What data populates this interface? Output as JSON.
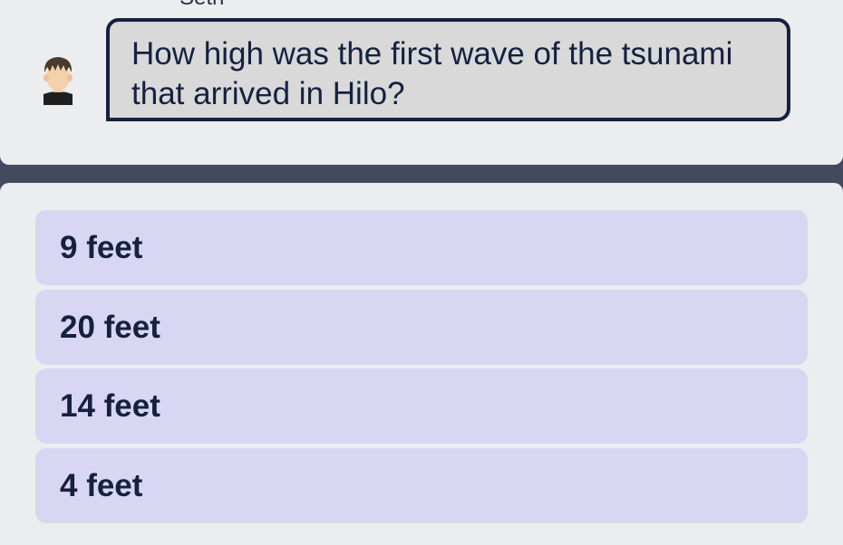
{
  "dialogue": {
    "speaker": "Seth",
    "question": "How high was the first wave of the tsunami that arrived in Hilo?"
  },
  "answers": [
    {
      "label": "9 feet"
    },
    {
      "label": "20 feet"
    },
    {
      "label": "14 feet"
    },
    {
      "label": "4 feet"
    }
  ],
  "colors": {
    "background_divider": "#444a5e",
    "panel": "#ebedee",
    "bubble_fill": "#d9d9d9",
    "bubble_border": "#15213f",
    "answer_fill": "#d8d6f3",
    "text": "#15213f"
  }
}
